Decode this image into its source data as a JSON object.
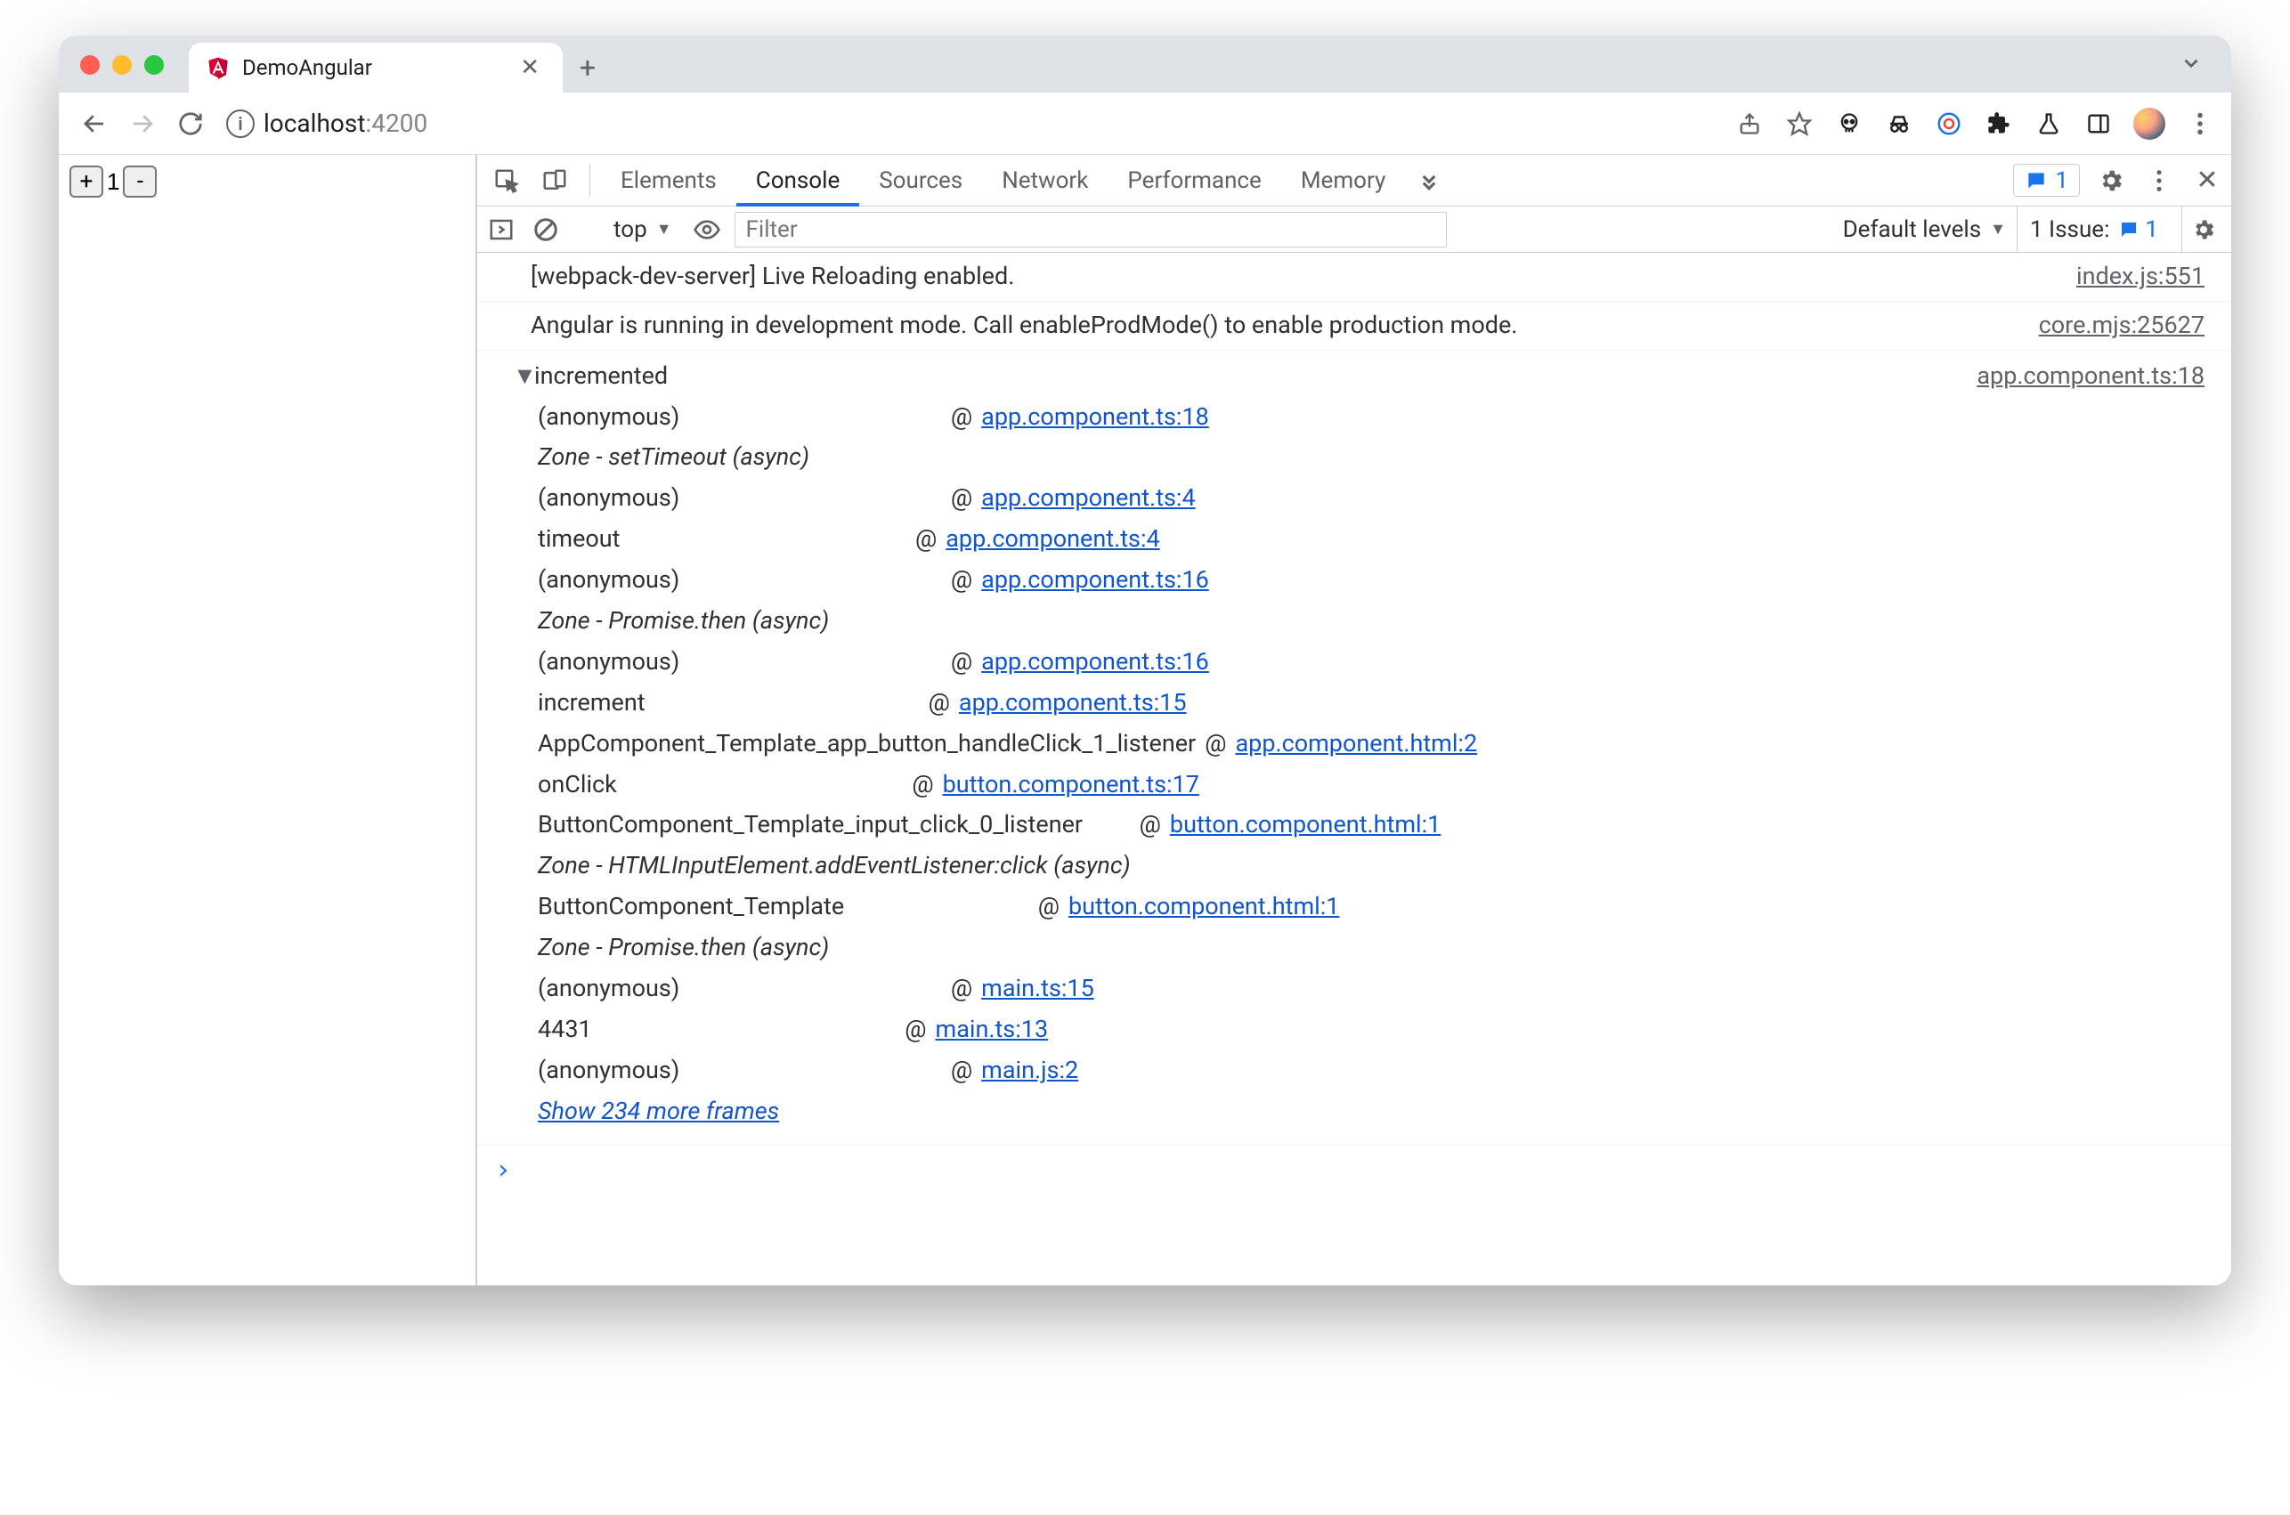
{
  "tab": {
    "title": "DemoAngular"
  },
  "url": {
    "host": "localhost",
    "port": ":4200"
  },
  "app": {
    "plus_label": "+",
    "minus_label": "-",
    "count": "1"
  },
  "devtools": {
    "tabs": {
      "elements": "Elements",
      "console": "Console",
      "sources": "Sources",
      "network": "Network",
      "performance": "Performance",
      "memory": "Memory"
    },
    "badge_count": "1",
    "subbar": {
      "context": "top",
      "filter_placeholder": "Filter",
      "levels": "Default levels",
      "issues_label": "1 Issue:",
      "issues_count": "1"
    },
    "logs": [
      {
        "msg": "[webpack-dev-server] Live Reloading enabled.",
        "src": "index.js:551"
      },
      {
        "msg": "Angular is running in development mode. Call enableProdMode() to enable production mode.",
        "src": "core.mjs:25627"
      }
    ],
    "trace": {
      "label": "incremented",
      "src": "app.component.ts:18",
      "show_more": "Show 234 more frames",
      "frames": [
        {
          "type": "frame",
          "fn": "(anonymous)",
          "loc": "app.component.ts:18"
        },
        {
          "type": "zone",
          "text": "Zone - setTimeout (async)"
        },
        {
          "type": "frame",
          "fn": "(anonymous)",
          "loc": "app.component.ts:4"
        },
        {
          "type": "frame",
          "fn": "timeout",
          "loc": "app.component.ts:4"
        },
        {
          "type": "frame",
          "fn": "(anonymous)",
          "loc": "app.component.ts:16"
        },
        {
          "type": "zone",
          "text": "Zone - Promise.then (async)"
        },
        {
          "type": "frame",
          "fn": "(anonymous)",
          "loc": "app.component.ts:16"
        },
        {
          "type": "frame",
          "fn": "increment",
          "loc": "app.component.ts:15"
        },
        {
          "type": "frame",
          "fn": "AppComponent_Template_app_button_handleClick_1_listener",
          "loc": "app.component.html:2"
        },
        {
          "type": "frame",
          "fn": "onClick",
          "loc": "button.component.ts:17"
        },
        {
          "type": "frame",
          "fn": "ButtonComponent_Template_input_click_0_listener",
          "loc": "button.component.html:1"
        },
        {
          "type": "zone",
          "text": "Zone - HTMLInputElement.addEventListener:click (async)"
        },
        {
          "type": "frame",
          "fn": "ButtonComponent_Template",
          "loc": "button.component.html:1"
        },
        {
          "type": "zone",
          "text": "Zone - Promise.then (async)"
        },
        {
          "type": "frame",
          "fn": "(anonymous)",
          "loc": "main.ts:15"
        },
        {
          "type": "frame",
          "fn": "4431",
          "loc": "main.ts:13"
        },
        {
          "type": "frame",
          "fn": "(anonymous)",
          "loc": "main.js:2"
        }
      ]
    }
  }
}
